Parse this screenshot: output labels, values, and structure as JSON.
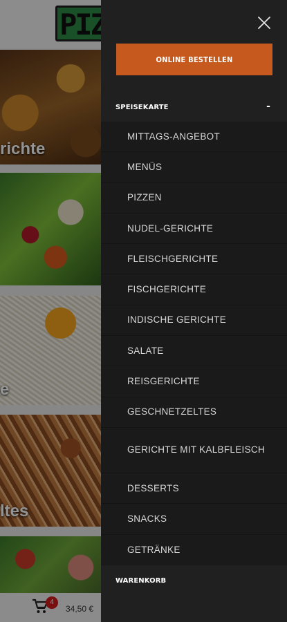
{
  "background": {
    "logo_text": "PIZ",
    "tiles": [
      {
        "label": "richte"
      },
      {
        "label": ""
      },
      {
        "label": "e"
      },
      {
        "label": "ltes"
      },
      {
        "label": ""
      }
    ],
    "cart": {
      "badge_count": "4",
      "total": "34,50 €",
      "icon": "shopping-cart-icon"
    }
  },
  "drawer": {
    "close_icon": "close-icon",
    "order_button": "ONLINE BESTELLEN",
    "sections": {
      "speisekarte": {
        "label": "SPEISEKARTE",
        "toggle": "-"
      },
      "warenkorb": {
        "label": "WARENKORB"
      }
    },
    "menu_items": [
      "MITTAGS-ANGEBOT",
      "MENÜS",
      "PIZZEN",
      "NUDEL-GERICHTE",
      "FLEISCHGERICHTE",
      "FISCHGERICHTE",
      "INDISCHE GERICHTE",
      "SALATE",
      "REISGERICHTE",
      "GESCHNETZELTES",
      "GERICHTE MIT KALBFLEISCH",
      "DESSERTS",
      "SNACKS",
      "GETRÄNKE"
    ]
  },
  "colors": {
    "drawer_bg": "#202020",
    "submenu_bg": "#1a1a1a",
    "accent": "#c65a1e",
    "cart_badge": "#d11a1a"
  }
}
